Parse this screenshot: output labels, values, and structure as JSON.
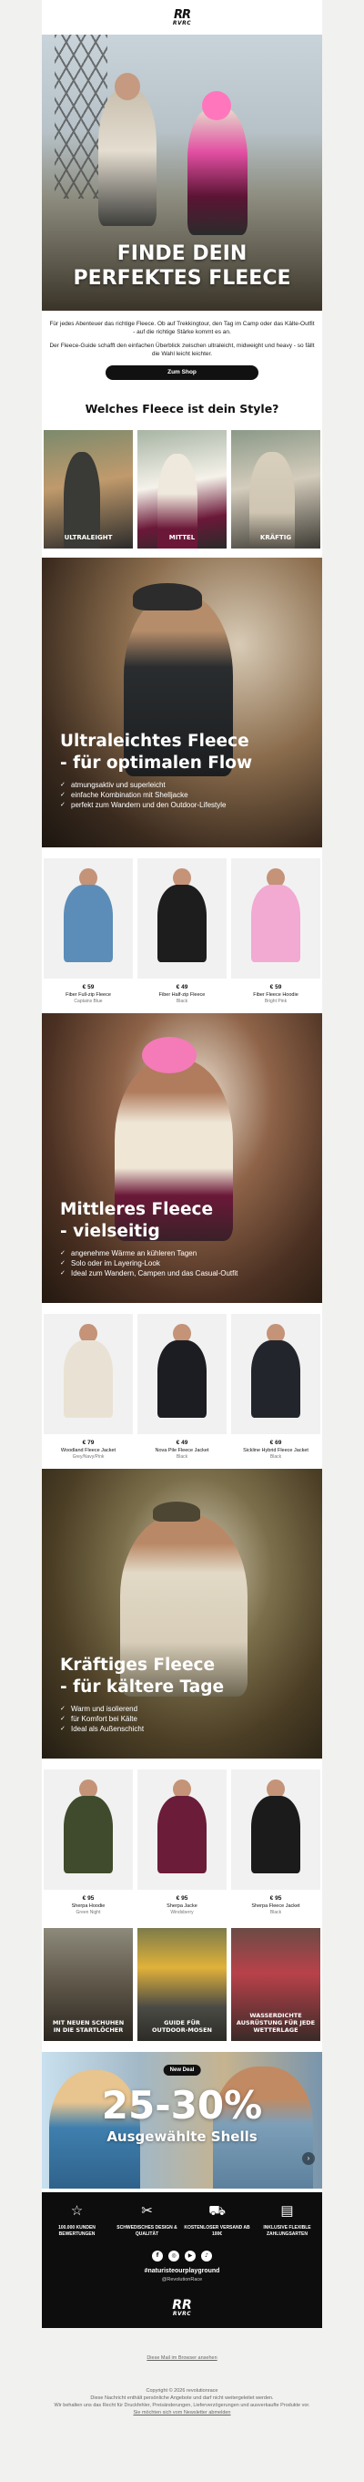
{
  "brand": {
    "logo_top": "RR",
    "logo_bottom": "RVRC"
  },
  "hero": {
    "title_line1": "FINDE DEIN",
    "title_line2": "PERFEKTES FLEECE"
  },
  "intro": {
    "p1": "Für jedes Abenteuer das richtige Fleece. Ob auf Trekkingtour, den Tag im Camp oder das Kälte-Outfit - auf die richtige Stärke kommt es an.",
    "p2": "Der Fleece-Guide schafft den einfachen Überblick zwischen ultraleicht, midweight und heavy - so fällt die Wahl leicht leichter.",
    "button": "Zum Shop"
  },
  "style_section": {
    "title": "Welches Fleece ist dein Style?",
    "tiles": [
      "ULTRALEIGHT",
      "MITTEL",
      "KRÄFTIG"
    ]
  },
  "features": [
    {
      "title_line1": "Ultraleichtes Fleece",
      "title_line2": "- für optimalen Flow",
      "bullets": [
        "atmungsaktiv und superleicht",
        "einfache Kombination mit Shelljacke",
        "perfekt zum Wandern und den Outdoor-Lifestyle"
      ]
    },
    {
      "title_line1": "Mittleres Fleece",
      "title_line2": "- vielseitig",
      "bullets": [
        "angenehme Wärme an kühleren Tagen",
        "Solo oder im Layering-Look",
        "Ideal zum Wandern, Campen und das Casual-Outfit"
      ]
    },
    {
      "title_line1": "Kräftiges Fleece",
      "title_line2": "- für kältere Tage",
      "bullets": [
        "Warm und isolierend",
        "für Komfort bei Kälte",
        "Ideal als Außenschicht"
      ]
    }
  ],
  "product_rows": [
    [
      {
        "price": "€ 59",
        "name": "Fiber Full-zip Fleece",
        "color": "Captains Blue",
        "swatch": "#5b8db8"
      },
      {
        "price": "€ 49",
        "name": "Fiber Half-zip Fleece",
        "color": "Black",
        "swatch": "#1d1d1d"
      },
      {
        "price": "€ 59",
        "name": "Fiber Fleece Hoodie",
        "color": "Bright Pink",
        "swatch": "#f2a9d2"
      }
    ],
    [
      {
        "price": "€ 79",
        "name": "Woodland Fleece Jacket",
        "color": "Grey/Navy/Pink",
        "swatch": "#e9e2d4"
      },
      {
        "price": "€ 49",
        "name": "Nova Pile Fleece Jacket",
        "color": "Black",
        "swatch": "#1c1d22"
      },
      {
        "price": "€ 69",
        "name": "Sickline Hybrid Fleece Jacket",
        "color": "Black",
        "swatch": "#23252c"
      }
    ],
    [
      {
        "price": "€ 95",
        "name": "Sherpa Hoodie",
        "color": "Green Night",
        "swatch": "#3f4b2c"
      },
      {
        "price": "€ 95",
        "name": "Sherpa Jacke",
        "color": "Windsberry",
        "swatch": "#6a1c38"
      },
      {
        "price": "€ 95",
        "name": "Sherpa Fleece Jacket",
        "color": "Black",
        "swatch": "#1b1b1b"
      }
    ]
  ],
  "guides": [
    {
      "line1": "MIT NEUEN SCHUHEN",
      "line2": "IN DIE STARTLÖCHER"
    },
    {
      "line1": "GUIDE FÜR",
      "line2": "OUTDOOR-MOSEN"
    },
    {
      "line1": "WASSERDICHTE",
      "line2": "AUSRÜSTUNG FÜR JEDE WETTERLAGE"
    }
  ],
  "sale": {
    "badge": "New Deal",
    "headline": "25-30%",
    "subline": "Ausgewählte Shells",
    "arrow": "›"
  },
  "footer": {
    "usps": [
      {
        "icon": "star",
        "glyph": "☆",
        "text": "100.000 KUNDEN BEWERTUNGEN"
      },
      {
        "icon": "leaf",
        "glyph": "✂",
        "text": "SCHWEDISCHES DESIGN & QUALITÄT"
      },
      {
        "icon": "truck",
        "glyph": "⛟",
        "text": "KOSTENLOSER VERSAND AB 100€"
      },
      {
        "icon": "card",
        "glyph": "▤",
        "text": "INKLUSIVE FLEXIBLE ZAHLUNGSARTEN"
      }
    ],
    "socials": [
      "f",
      "◎",
      "▶",
      "♪"
    ],
    "hashtag": "#naturisteourplayground",
    "handle": "@RevolutionRace",
    "logo_top": "RR",
    "logo_bottom": "RVRC"
  },
  "legal": {
    "webview": "Diese Mail im Browser ansehen",
    "copyright": "Copyright © 2026 revolutionrace",
    "l1": "Diese Nachricht enthält persönliche Angebote und darf nicht weitergeleitet werden.",
    "l2": "Wir behalten uns das Recht für Druckfehler, Preisänderungen, Lieferverzögerungen und ausverkaufte Produkte vor.",
    "unsubscribe": "Sie möchten sich vom Newsletter abmelden"
  }
}
